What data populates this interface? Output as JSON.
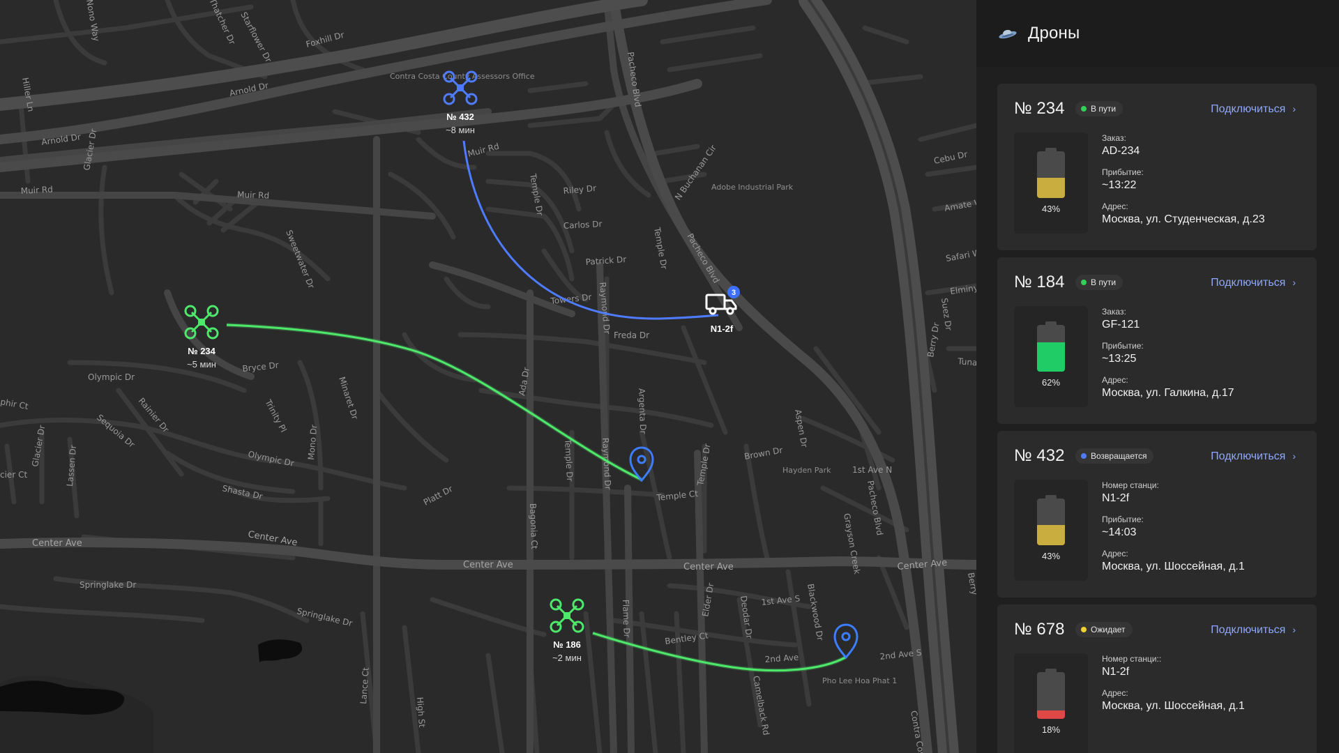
{
  "colors": {
    "accent_blue": "#4f7cff",
    "route_green": "#4ee86a",
    "link": "#8fa7ff",
    "status_green": "#31d158",
    "status_blue": "#4f7cff",
    "status_yellow": "#f2d233",
    "battery_yellow": "#c9ae3f",
    "battery_green": "#1fcc66",
    "battery_red": "#e04848"
  },
  "panel": {
    "logo_icon": "drone-logo-icon",
    "title": "Дроны"
  },
  "cards": [
    {
      "number": "№ 234",
      "status": "В пути",
      "status_color": "#31d158",
      "connect": "Подключиться",
      "battery_pct": "43%",
      "battery_level": 0.43,
      "battery_color": "#c9ae3f",
      "fields": [
        {
          "label": "Заказ:",
          "value": "AD-234"
        },
        {
          "label": "Прибытие:",
          "value": "~13:22"
        },
        {
          "label": "Адрес:",
          "value": "Москва, ул. Студенческая, д.23"
        }
      ]
    },
    {
      "number": "№ 184",
      "status": "В пути",
      "status_color": "#31d158",
      "connect": "Подключиться",
      "battery_pct": "62%",
      "battery_level": 0.62,
      "battery_color": "#1fcc66",
      "fields": [
        {
          "label": "Заказ:",
          "value": "GF-121"
        },
        {
          "label": "Прибытие:",
          "value": "~13:25"
        },
        {
          "label": "Адрес:",
          "value": "Москва, ул. Галкина, д.17"
        }
      ]
    },
    {
      "number": "№ 432",
      "status": "Возвращается",
      "status_color": "#4f7cff",
      "connect": "Подключиться",
      "battery_pct": "43%",
      "battery_level": 0.43,
      "battery_color": "#c9ae3f",
      "fields": [
        {
          "label": "Номер станци:",
          "value": "N1-2f"
        },
        {
          "label": "Прибытие:",
          "value": "~14:03"
        },
        {
          "label": "Адрес:",
          "value": "Москва, ул. Шоссейная, д.1"
        }
      ]
    },
    {
      "number": "№ 678",
      "status": "Ожидает",
      "status_color": "#f2d233",
      "connect": "Подключиться",
      "battery_pct": "18%",
      "battery_level": 0.18,
      "battery_color": "#e04848",
      "fields": [
        {
          "label": "Номер станци::",
          "value": "N1-2f"
        },
        {
          "label": "Адрес:",
          "value": "Москва, ул. Шоссейная, д.1"
        }
      ]
    }
  ],
  "map": {
    "drones": [
      {
        "id": "drone-432",
        "label": "№ 432",
        "eta": "~8 мин",
        "color": "#4f7cff",
        "icon": "drone-icon"
      },
      {
        "id": "drone-234",
        "label": "№ 234",
        "eta": "~5 мин",
        "color": "#4ee86a",
        "icon": "drone-icon"
      },
      {
        "id": "drone-186",
        "label": "№ 186",
        "eta": "~2 мин",
        "color": "#4ee86a",
        "icon": "drone-icon"
      }
    ],
    "station": {
      "label": "N1-2f",
      "badge": "3",
      "icon": "truck-icon"
    },
    "streets": [
      "Arnold Dr",
      "Arnold Dr",
      "Muir Rd",
      "Muir Rd",
      "Muir Rd",
      "Foxhill Dr",
      "Starflower Dr",
      "Hiller Ln",
      "Glacier Dr",
      "Sweetwater Dr",
      "Olympic Dr",
      "Bryce Dr",
      "Rainier Dr",
      "Sequoia Dr",
      "Trinity Pl",
      "Minaret Dr",
      "Olympic Dr",
      "Mono Dr",
      "Shasta Dr",
      "Lassen Dr",
      "Glacier Dr",
      "Platt Dr",
      "Center Ave",
      "Center Ave",
      "Center Ave",
      "Center Ave",
      "Center Ave",
      "Springlake Dr",
      "Springlake Dr",
      "Temple Dr",
      "Riley Dr",
      "Carlos Dr",
      "Patrick Dr",
      "Towers Dr",
      "Raymond Dr",
      "Freda Dr",
      "Ada Dr",
      "Argenta Dr",
      "Temple Dr",
      "Raymond Dr",
      "Bagonia Ct",
      "Temple Ct",
      "Temple Dr",
      "Brown Dr",
      "Aspen Dr",
      "1st Ave N",
      "Pacheco Blvd",
      "Pacheco Blvd",
      "Pacheco Blvd",
      "N Buchanan Cir",
      "Temple Dr",
      "Flame Dr",
      "Bentley Ct",
      "Elder Dr",
      "Deodar Dr",
      "Camelback Rd",
      "1st Ave S",
      "Blackwood Dr",
      "2nd Ave",
      "2nd Ave S",
      "Lance Ct",
      "High St",
      "Cebu Dr",
      "Amate Way",
      "Safari Way",
      "Elminy",
      "Suez Dr",
      "Berry Dr",
      "Tuna",
      "Grayson Creek",
      "Contra Costa",
      "Berry",
      "phir Ct",
      "cier Ct",
      "Nono Way",
      "Thatcher Dr"
    ],
    "places": [
      "Contra Costa County Assessors Office",
      "Adobe Industrial Park",
      "Hayden Park",
      "Pho Lee Hoa Phat 1"
    ],
    "pins": [
      {
        "name": "destination-pin-234",
        "icon": "map-pin-icon"
      },
      {
        "name": "destination-pin-186",
        "icon": "map-pin-icon"
      }
    ]
  }
}
